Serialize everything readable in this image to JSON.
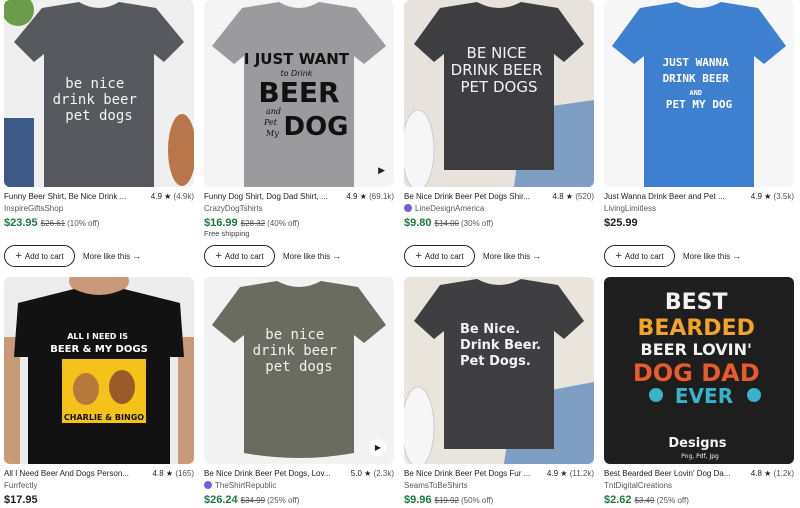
{
  "products": [
    {
      "title": "Funny Beer Shirt, Be Nice Drink ...",
      "rating": "4.9",
      "reviews": "(4.9k)",
      "shop": "InspireGiftsShop",
      "price": "$23.95",
      "original": "$26.61",
      "discount": "(10% off)"
    },
    {
      "title": "Funny Dog Shirt, Dog Dad Shirt, ...",
      "rating": "4.9",
      "reviews": "(69.1k)",
      "shop": "CrazyDogTshirts",
      "price": "$16.99",
      "original": "$28.32",
      "discount": "(40% off)",
      "shipping": "Free shipping"
    },
    {
      "title": "Be Nice Drink Beer Pet Dogs Shir...",
      "rating": "4.8",
      "reviews": "(520)",
      "shop": "LineDesignAmerica",
      "price": "$9.80",
      "original": "$14.00",
      "discount": "(30% off)"
    },
    {
      "title": "Just Wanna Drink Beer and Pet ...",
      "rating": "4.9",
      "reviews": "(3.5k)",
      "shop": "LivingLimitless",
      "price": "$25.99"
    },
    {
      "title": "All I Need Beer And Dogs Person...",
      "rating": "4.8",
      "reviews": "(165)",
      "shop": "Furrfectly",
      "price": "$17.95"
    },
    {
      "title": "Be Nice Drink Beer Pet Dogs, Lov...",
      "rating": "5.0",
      "reviews": "(2.3k)",
      "shop": "TheShirtRepublic",
      "price": "$26.24",
      "original": "$34.99",
      "discount": "(25% off)"
    },
    {
      "title": "Be Nice Drink Beer Pet Dogs Fur ...",
      "rating": "4.9",
      "reviews": "(11.2k)",
      "shop": "SeamsToBeShirts",
      "price": "$9.96",
      "original": "$19.92",
      "discount": "(50% off)"
    },
    {
      "title": "Best Bearded Beer Lovin' Dog Da...",
      "rating": "4.8",
      "reviews": "(1.2k)",
      "shop": "TntDigitalCreations",
      "price": "$2.62",
      "original": "$3.49",
      "discount": "(25% off)"
    }
  ],
  "buttons": {
    "add_to_cart": "Add to cart",
    "more_like_this": "More like this"
  },
  "shirt_text": {
    "p1": [
      "be nice",
      "drink beer",
      "pet dogs"
    ],
    "p2": [
      "I JUST WANT",
      "to Drink",
      "BEER",
      "and",
      "Pet",
      "My",
      "DOG"
    ],
    "p3": [
      "BE NICE",
      "DRINK BEER",
      "PET DOGS"
    ],
    "p4": [
      "JUST WANNA",
      "DRINK BEER",
      "AND",
      "PET MY DOG"
    ],
    "p5": [
      "ALL I NEED IS",
      "BEER & MY DOGS",
      "CHARLIE & BINGO"
    ],
    "p6": [
      "be nice",
      "drink beer",
      "pet dogs"
    ],
    "p7": [
      "Be Nice.",
      "Drink Beer.",
      "Pet Dogs."
    ],
    "p8": [
      "BEST",
      "BEARDED",
      "BEER LOVIN'",
      "DOG DAD",
      "EVER",
      "Designs",
      "Png, Pdf, Jpg"
    ]
  },
  "colors": {
    "sale_price": "#1a7b3c",
    "star_seller_badge": "#7b5bd6"
  }
}
